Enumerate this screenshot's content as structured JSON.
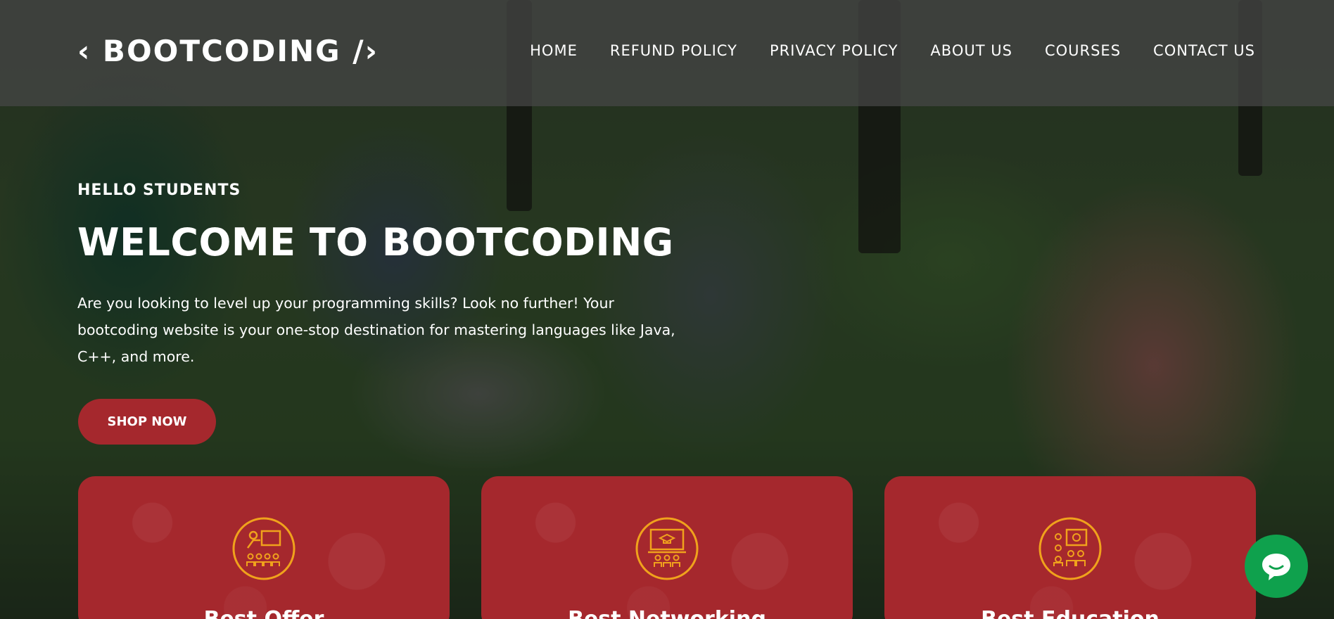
{
  "header": {
    "logo": "‹ BOOTCODING /›",
    "nav": [
      "HOME",
      "REFUND POLICY",
      "PRIVACY POLICY",
      "ABOUT US",
      "COURSES",
      "CONTACT US"
    ]
  },
  "hero": {
    "eyebrow": "HELLO STUDENTS",
    "title": "WELCOME TO BOOTCODING",
    "description": "Are you looking to level up your programming skills? Look no further! Your bootcoding website is your one-stop destination for mastering languages like Java, C++, and more.",
    "cta_label": "SHOP NOW"
  },
  "cards": [
    {
      "title": "Best Offer",
      "icon": "teacher-presentation-icon"
    },
    {
      "title": "Best Networking",
      "icon": "graduation-board-icon"
    },
    {
      "title": "Best Education",
      "icon": "team-learning-icon"
    }
  ],
  "chat": {
    "icon": "chat-bubble-icon"
  },
  "colors": {
    "accent": "#a5282d",
    "icon_orange": "#f0a21c",
    "chat_green": "#0fa14d"
  }
}
